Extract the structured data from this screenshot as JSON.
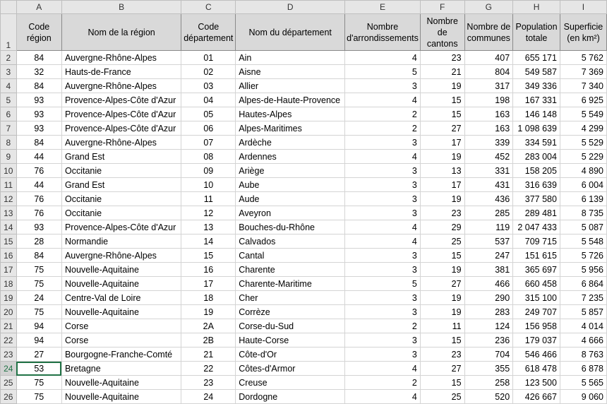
{
  "columns": [
    "A",
    "B",
    "C",
    "D",
    "E",
    "F",
    "G",
    "H",
    "I"
  ],
  "header_row_number": "1",
  "headers": [
    "Code région",
    "Nom de la région",
    "Code département",
    "Nom du département",
    "Nombre d'arrondissements",
    "Nombre de cantons",
    "Nombre de communes",
    "Population totale",
    "Superficie (en km²)"
  ],
  "rows": [
    {
      "n": "2",
      "cells": [
        "84",
        "Auvergne-Rhône-Alpes",
        "01",
        "Ain",
        "4",
        "23",
        "407",
        "655 171",
        "5 762"
      ]
    },
    {
      "n": "3",
      "cells": [
        "32",
        "Hauts-de-France",
        "02",
        "Aisne",
        "5",
        "21",
        "804",
        "549 587",
        "7 369"
      ]
    },
    {
      "n": "4",
      "cells": [
        "84",
        "Auvergne-Rhône-Alpes",
        "03",
        "Allier",
        "3",
        "19",
        "317",
        "349 336",
        "7 340"
      ]
    },
    {
      "n": "5",
      "cells": [
        "93",
        "Provence-Alpes-Côte d'Azur",
        "04",
        "Alpes-de-Haute-Provence",
        "4",
        "15",
        "198",
        "167 331",
        "6 925"
      ]
    },
    {
      "n": "6",
      "cells": [
        "93",
        "Provence-Alpes-Côte d'Azur",
        "05",
        "Hautes-Alpes",
        "2",
        "15",
        "163",
        "146 148",
        "5 549"
      ]
    },
    {
      "n": "7",
      "cells": [
        "93",
        "Provence-Alpes-Côte d'Azur",
        "06",
        "Alpes-Maritimes",
        "2",
        "27",
        "163",
        "1 098 639",
        "4 299"
      ]
    },
    {
      "n": "8",
      "cells": [
        "84",
        "Auvergne-Rhône-Alpes",
        "07",
        "Ardèche",
        "3",
        "17",
        "339",
        "334 591",
        "5 529"
      ]
    },
    {
      "n": "9",
      "cells": [
        "44",
        "Grand Est",
        "08",
        "Ardennes",
        "4",
        "19",
        "452",
        "283 004",
        "5 229"
      ]
    },
    {
      "n": "10",
      "cells": [
        "76",
        "Occitanie",
        "09",
        "Ariège",
        "3",
        "13",
        "331",
        "158 205",
        "4 890"
      ]
    },
    {
      "n": "11",
      "cells": [
        "44",
        "Grand Est",
        "10",
        "Aube",
        "3",
        "17",
        "431",
        "316 639",
        "6 004"
      ]
    },
    {
      "n": "12",
      "cells": [
        "76",
        "Occitanie",
        "11",
        "Aude",
        "3",
        "19",
        "436",
        "377 580",
        "6 139"
      ]
    },
    {
      "n": "13",
      "cells": [
        "76",
        "Occitanie",
        "12",
        "Aveyron",
        "3",
        "23",
        "285",
        "289 481",
        "8 735"
      ]
    },
    {
      "n": "14",
      "cells": [
        "93",
        "Provence-Alpes-Côte d'Azur",
        "13",
        "Bouches-du-Rhône",
        "4",
        "29",
        "119",
        "2 047 433",
        "5 087"
      ]
    },
    {
      "n": "15",
      "cells": [
        "28",
        "Normandie",
        "14",
        "Calvados",
        "4",
        "25",
        "537",
        "709 715",
        "5 548"
      ]
    },
    {
      "n": "16",
      "cells": [
        "84",
        "Auvergne-Rhône-Alpes",
        "15",
        "Cantal",
        "3",
        "15",
        "247",
        "151 615",
        "5 726"
      ]
    },
    {
      "n": "17",
      "cells": [
        "75",
        "Nouvelle-Aquitaine",
        "16",
        "Charente",
        "3",
        "19",
        "381",
        "365 697",
        "5 956"
      ]
    },
    {
      "n": "18",
      "cells": [
        "75",
        "Nouvelle-Aquitaine",
        "17",
        "Charente-Maritime",
        "5",
        "27",
        "466",
        "660 458",
        "6 864"
      ]
    },
    {
      "n": "19",
      "cells": [
        "24",
        "Centre-Val de Loire",
        "18",
        "Cher",
        "3",
        "19",
        "290",
        "315 100",
        "7 235"
      ]
    },
    {
      "n": "20",
      "cells": [
        "75",
        "Nouvelle-Aquitaine",
        "19",
        "Corrèze",
        "3",
        "19",
        "283",
        "249 707",
        "5 857"
      ]
    },
    {
      "n": "21",
      "cells": [
        "94",
        "Corse",
        "2A",
        "Corse-du-Sud",
        "2",
        "11",
        "124",
        "156 958",
        "4 014"
      ]
    },
    {
      "n": "22",
      "cells": [
        "94",
        "Corse",
        "2B",
        "Haute-Corse",
        "3",
        "15",
        "236",
        "179 037",
        "4 666"
      ]
    },
    {
      "n": "23",
      "cells": [
        "27",
        "Bourgogne-Franche-Comté",
        "21",
        "Côte-d'Or",
        "3",
        "23",
        "704",
        "546 466",
        "8 763"
      ]
    },
    {
      "n": "24",
      "cells": [
        "53",
        "Bretagne",
        "22",
        "Côtes-d'Armor",
        "4",
        "27",
        "355",
        "618 478",
        "6 878"
      ]
    },
    {
      "n": "25",
      "cells": [
        "75",
        "Nouvelle-Aquitaine",
        "23",
        "Creuse",
        "2",
        "15",
        "258",
        "123 500",
        "5 565"
      ]
    },
    {
      "n": "26",
      "cells": [
        "75",
        "Nouvelle-Aquitaine",
        "24",
        "Dordogne",
        "4",
        "25",
        "520",
        "426 667",
        "9 060"
      ]
    }
  ],
  "selected_row": "24"
}
